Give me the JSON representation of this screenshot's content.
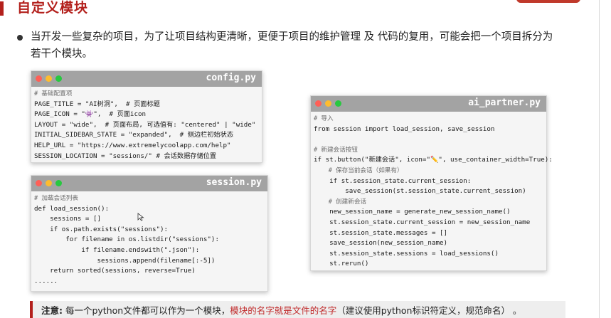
{
  "page": {
    "title": "自定义模块",
    "bullet": "当开发一些复杂的项目，为了让项目结构更清晰，更便于项目的维护管理  及  代码的复用，可能会把一个项目拆分为若干个模块。"
  },
  "windows": {
    "config": {
      "title": "config.py",
      "lines": [
        "# 基础配置项",
        "PAGE_TITLE = \"AI树洞\",  # 页面标题",
        "PAGE_ICON = \"👾\",  # 页面icon",
        "LAYOUT = \"wide\",  # 页面布局, 可选值有: \"centered\" | \"wide\"",
        "INITIAL_SIDEBAR_STATE = \"expanded\",  # 侧边栏初始状态",
        "HELP_URL = \"https://www.extremelycoolapp.com/help\"",
        "SESSION_LOCATION = \"sessions/\" # 会话数据存储位置"
      ]
    },
    "session": {
      "title": "session.py",
      "lines": [
        "# 加载会话列表",
        "def load_session():",
        "    sessions = []",
        "    if os.path.exists(\"sessions\"):",
        "        for filename in os.listdir(\"sessions\"):",
        "            if filename.endswith(\".json\"):",
        "                sessions.append(filename[:-5])",
        "    return sorted(sessions, reverse=True)",
        "......"
      ]
    },
    "partner": {
      "title": "ai_partner.py",
      "lines": [
        "# 导入",
        "from session import load_session, save_session",
        "",
        "# 新建会话按钮",
        "if st.button(\"新建会话\", icon=\"✏️\", use_container_width=True):",
        "    # 保存当前会话（如果有）",
        "    if st.session_state.current_session:",
        "        save_session(st.session_state.current_session)",
        "    # 创建新会话",
        "    new_session_name = generate_new_session_name()",
        "    st.session_state.current_session = new_session_name",
        "    st.session_state.messages = []",
        "    save_session(new_session_name)",
        "    st.session_state.sessions = load_sessions()",
        "    st.rerun()"
      ]
    }
  },
  "note": {
    "label": "注意:",
    "text1": " 每一个python文件都可以作为一个模块，",
    "highlight": "模块的名字就是文件的名字",
    "text2": "（建议使用python标识符定义，规范命名）  。"
  },
  "colors": {
    "accent": "#b3201c",
    "header": "#a3a3a3"
  }
}
